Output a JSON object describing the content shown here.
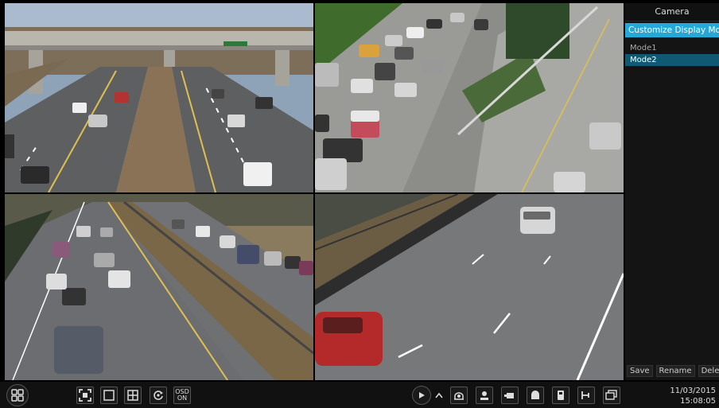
{
  "panel": {
    "title": "Camera",
    "custom_mode_label": "Customize Display Mode",
    "modes": [
      "Mode1",
      "Mode2"
    ],
    "selected_mode": "Mode2",
    "buttons": {
      "save": "Save",
      "rename": "Rename",
      "delete": "Delete"
    }
  },
  "toolbar": {
    "osd_line1": "OSD",
    "osd_line2": "ON",
    "icons": [
      "start-menu-icon",
      "fullscreen-icon",
      "single-view-icon",
      "quad-view-icon",
      "sequence-icon",
      "osd-icon",
      "play-icon",
      "expand-up-icon",
      "ptz-icon",
      "snapshot-icon",
      "record-icon",
      "audio-icon",
      "zoom-icon",
      "network-icon",
      "playback-icon"
    ]
  },
  "clock": {
    "date": "11/03/2015",
    "time": "15:08:05"
  },
  "colors": {
    "accent": "#23a8d8",
    "selected": "#0f5a72",
    "background": "#000000"
  }
}
